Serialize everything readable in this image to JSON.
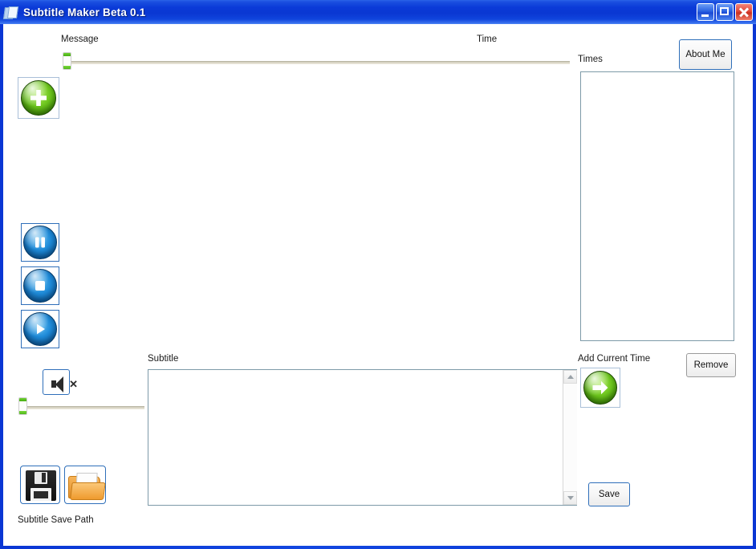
{
  "window": {
    "title": "Subtitle Maker Beta 0.1",
    "icon": "document-icon",
    "controls": {
      "minimize": "minimize-icon",
      "maximize": "maximize-icon",
      "close": "close-icon"
    }
  },
  "labels": {
    "message": "Message",
    "time": "Time",
    "times": "Times",
    "subtitle": "Subtitle",
    "add_current_time": "Add Current Time",
    "subtitle_save_path": "Subtitle Save Path"
  },
  "buttons": {
    "about_me": "About Me",
    "remove": "Remove",
    "save": "Save",
    "add": "add-plus-icon",
    "pause": "pause-icon",
    "stop": "stop-icon",
    "play": "play-icon",
    "mute": "mute-speaker-icon",
    "save_file": "floppy-disk-icon",
    "browse_folder": "open-folder-icon",
    "add_time_arrow": "green-arrow-right-icon"
  },
  "fields": {
    "times_list_value": "",
    "subtitle_value": "",
    "subtitle_placeholder": ""
  },
  "sliders": {
    "seek_value": 0,
    "volume_value": 0
  },
  "colors": {
    "title_bar": "#0a36d4",
    "accent_green": "#6cc41d",
    "accent_blue": "#1f8bd8",
    "folder_orange": "#ef9b2e",
    "button_border": "#2f6fba"
  }
}
